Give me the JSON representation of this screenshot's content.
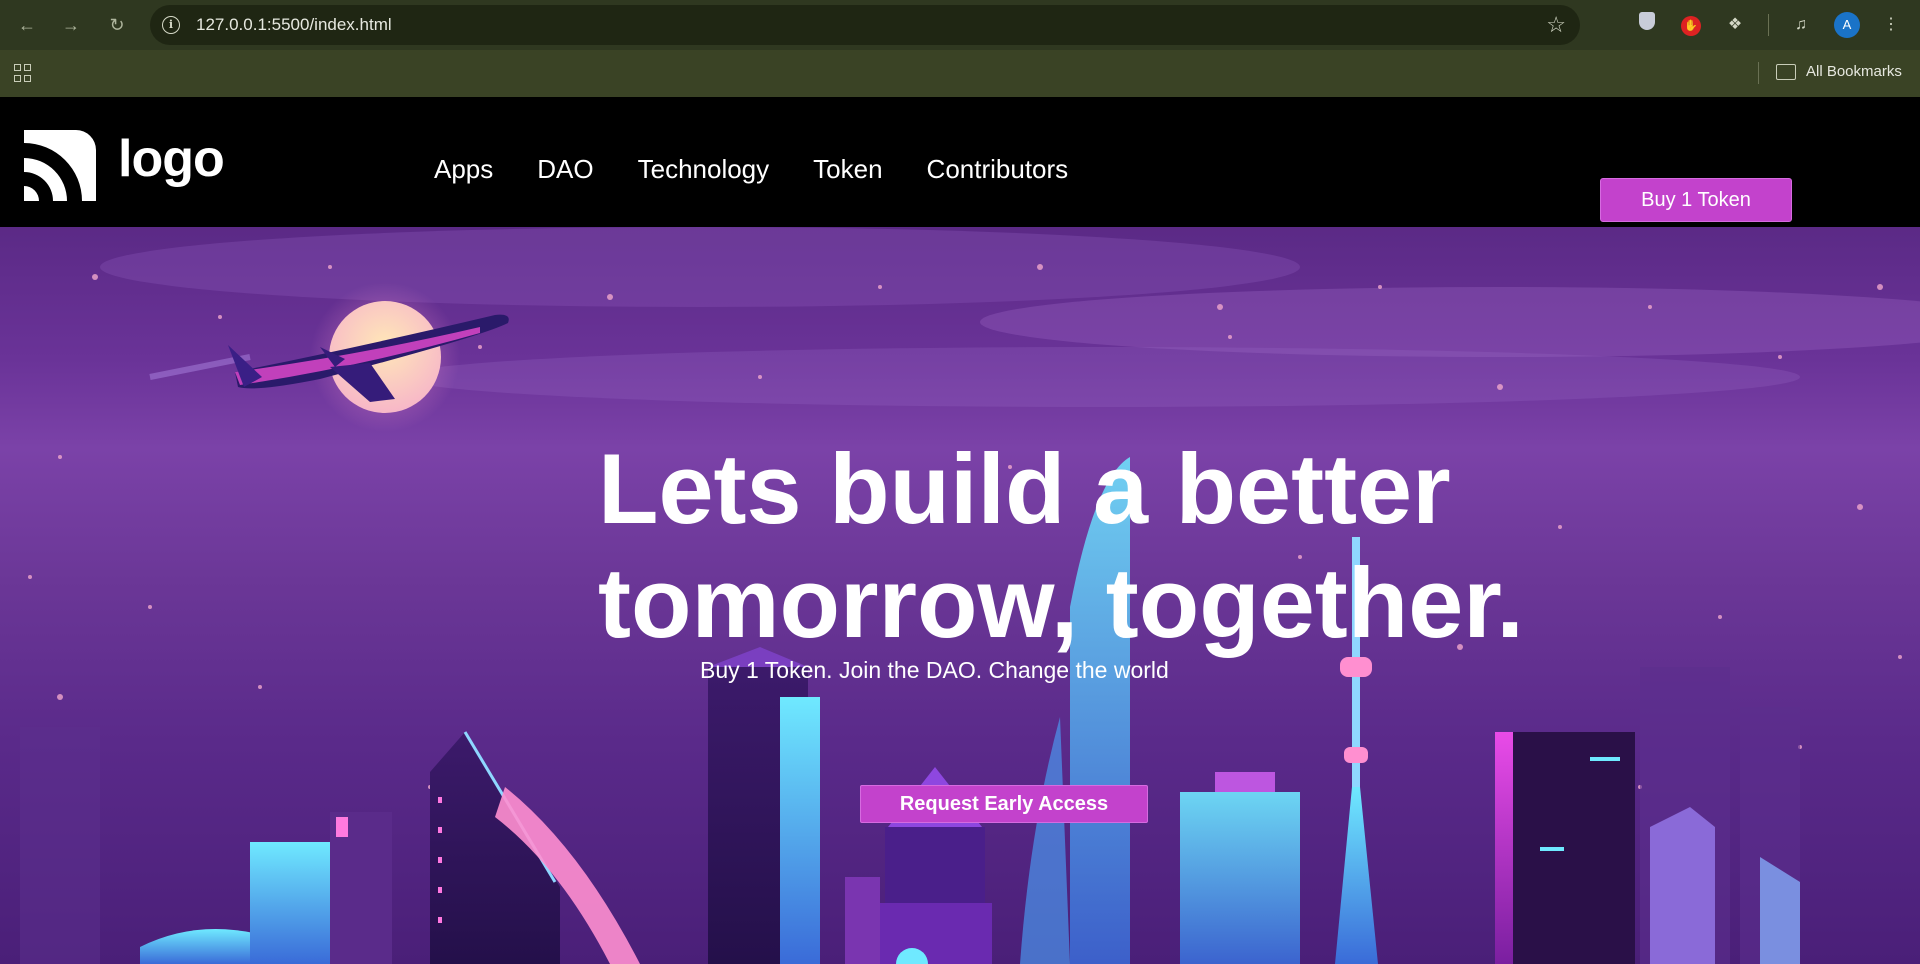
{
  "browser": {
    "url": "127.0.0.1:5500/index.html",
    "back_icon": "arrow-left-icon",
    "forward_icon": "arrow-right-icon",
    "reload_icon": "reload-icon",
    "profile_initial": "A",
    "bookmarks_label": "All Bookmarks"
  },
  "site": {
    "logo_text": "logo",
    "nav": [
      "Apps",
      "DAO",
      "Technology",
      "Token",
      "Contributors"
    ],
    "buy_label": "Buy 1 Token",
    "accent_color": "#c342cc"
  },
  "hero": {
    "headline_line1": "Lets build a better",
    "headline_line2": "tomorrow, together.",
    "tagline": "Buy 1 Token. Join the DAO. Change the world",
    "cta_label": "Request Early Access"
  }
}
